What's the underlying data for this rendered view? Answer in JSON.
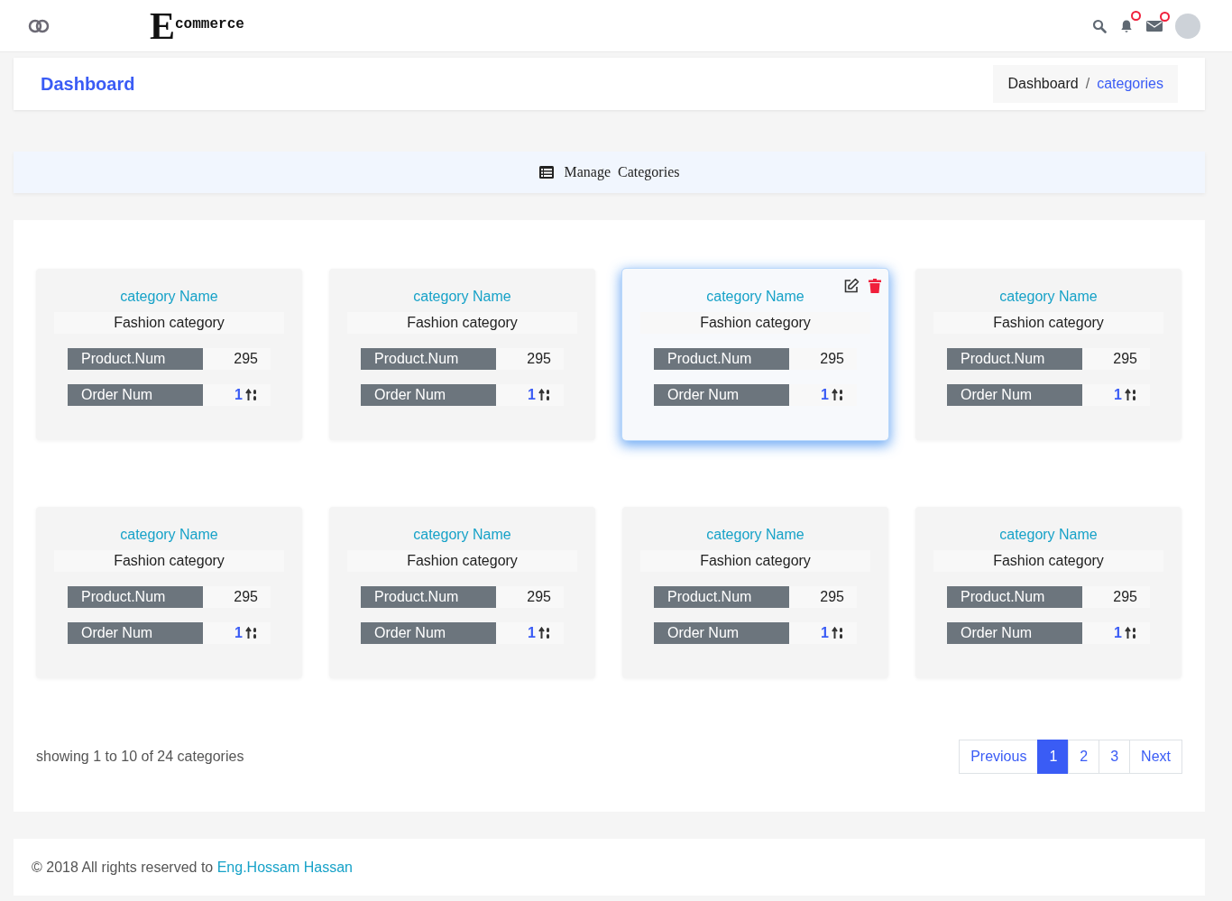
{
  "header": {
    "logo_initial": "E",
    "logo_text": "commerce"
  },
  "page_header": {
    "title": "Dashboard",
    "breadcrumb_separator": "/",
    "breadcrumb": [
      {
        "label": "Dashboard",
        "selected": false
      },
      {
        "label": "categories",
        "selected": true
      }
    ]
  },
  "section_title": "Manage  Categories",
  "categories": [
    {
      "heading": "category Name",
      "name": "Fashion category",
      "product_label": "Product.Num",
      "product_value": "295",
      "order_label": "Order Num",
      "order_value": "1",
      "selected": false
    },
    {
      "heading": "category Name",
      "name": "Fashion category",
      "product_label": "Product.Num",
      "product_value": "295",
      "order_label": "Order Num",
      "order_value": "1",
      "selected": false
    },
    {
      "heading": "category Name",
      "name": "Fashion category",
      "product_label": "Product.Num",
      "product_value": "295",
      "order_label": "Order Num",
      "order_value": "1",
      "selected": true
    },
    {
      "heading": "category Name",
      "name": "Fashion category",
      "product_label": "Product.Num",
      "product_value": "295",
      "order_label": "Order Num",
      "order_value": "1",
      "selected": false
    },
    {
      "heading": "category Name",
      "name": "Fashion category",
      "product_label": "Product.Num",
      "product_value": "295",
      "order_label": "Order Num",
      "order_value": "1",
      "selected": false
    },
    {
      "heading": "category Name",
      "name": "Fashion category",
      "product_label": "Product.Num",
      "product_value": "295",
      "order_label": "Order Num",
      "order_value": "1",
      "selected": false
    },
    {
      "heading": "category Name",
      "name": "Fashion category",
      "product_label": "Product.Num",
      "product_value": "295",
      "order_label": "Order Num",
      "order_value": "1",
      "selected": false
    },
    {
      "heading": "category Name",
      "name": "Fashion category",
      "product_label": "Product.Num",
      "product_value": "295",
      "order_label": "Order Num",
      "order_value": "1",
      "selected": false
    }
  ],
  "summary": "showing 1 to 10 of 24 categories",
  "pagination": [
    {
      "label": "Previous",
      "selected": false
    },
    {
      "label": "1",
      "selected": true
    },
    {
      "label": "2",
      "selected": false
    },
    {
      "label": "3",
      "selected": false
    },
    {
      "label": "Next",
      "selected": false
    }
  ],
  "footer": {
    "text": "© 2018 All rights reserved to ",
    "link": "Eng.Hossam Hassan"
  }
}
